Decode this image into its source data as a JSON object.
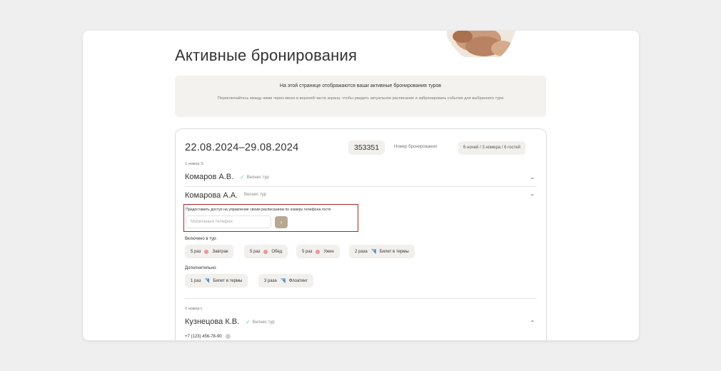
{
  "page": {
    "title": "Активные бронирования"
  },
  "info": {
    "headline": "На этой странице отображаются ваши активные бронирования туров",
    "text": "Переключайтесь между ними через меню в верхней части экрана, чтобы увидеть актуальное расписание и забронировать события для выбранного тура"
  },
  "booking": {
    "dates": "22.08.2024–29.08.2024",
    "number": "353351",
    "number_label": "Номер бронирования",
    "summary": "6 ночей / 3 номера / 6 гостей",
    "rooms": [
      {
        "label": "1 номер S",
        "guests": [
          {
            "name": "Комаров А.В.",
            "tour": "Велнес тур",
            "verified": true,
            "expanded": false
          },
          {
            "name": "Комарова А.А.",
            "tour": "Велнес тур",
            "verified": false,
            "expanded": true,
            "access_text": "Предоставить доступ на управление своим расписанием по номеру телефона гостя",
            "phone_placeholder": "Мобильный телефон",
            "included_label": "Включено в тур:",
            "included": [
              {
                "count": "5 раз",
                "icon": "food-icon",
                "name": "Завтрак"
              },
              {
                "count": "5 раз",
                "icon": "food-icon",
                "name": "Обед"
              },
              {
                "count": "5 раз",
                "icon": "food-icon",
                "name": "Ужин"
              },
              {
                "count": "2 раза",
                "icon": "ticket-icon",
                "name": "Билет в термы"
              }
            ],
            "extra_label": "Дополнительно:",
            "extra": [
              {
                "count": "1 раз",
                "icon": "ticket-icon",
                "name": "Билет в термы"
              },
              {
                "count": "3 раза",
                "icon": "ticket-icon",
                "name": "Флоатинг"
              }
            ]
          }
        ]
      },
      {
        "label": "2 номер L",
        "guests": [
          {
            "name": "Кузнецова К.В.",
            "tour": "Велнес тур",
            "verified": true,
            "expanded": true,
            "phone": "+7 (123) 456-78-90"
          }
        ]
      }
    ]
  },
  "colors": {
    "accent": "#b8a892",
    "highlight_border": "#a32a2a",
    "check": "#6cc3a0"
  }
}
